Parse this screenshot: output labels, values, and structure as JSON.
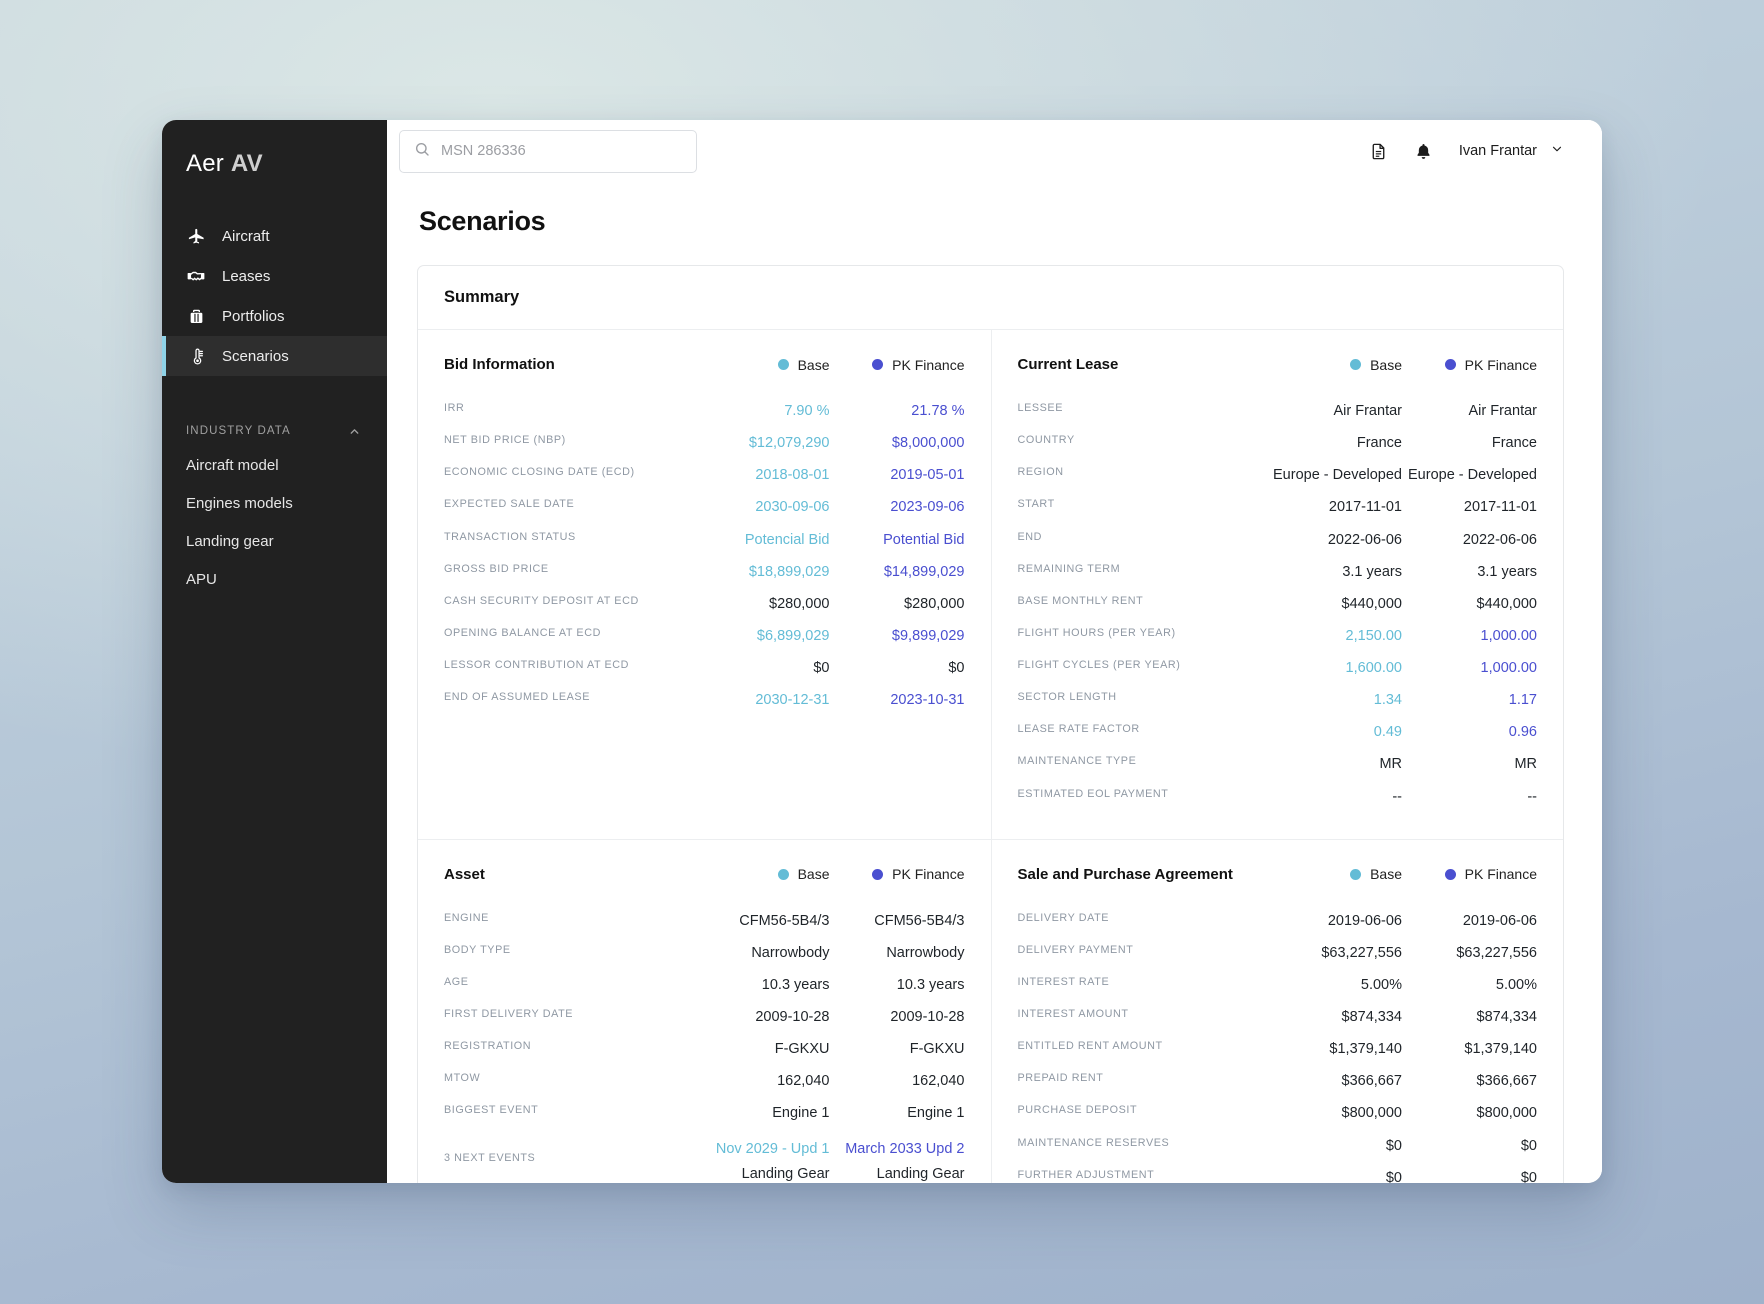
{
  "brand": {
    "part1": "Aer",
    "part2": "AV"
  },
  "sidebar": {
    "items": [
      {
        "label": "Aircraft",
        "icon": "airplane-icon",
        "active": false
      },
      {
        "label": "Leases",
        "icon": "handshake-icon",
        "active": false
      },
      {
        "label": "Portfolios",
        "icon": "briefcase-icon",
        "active": false
      },
      {
        "label": "Scenarios",
        "icon": "thermometer-icon",
        "active": true
      }
    ],
    "section": {
      "label": "INDUSTRY DATA",
      "chevron": "chevron-up-icon"
    },
    "sub_items": [
      {
        "label": "Aircraft model"
      },
      {
        "label": "Engines models"
      },
      {
        "label": "Landing gear"
      },
      {
        "label": "APU"
      }
    ]
  },
  "topbar": {
    "search": {
      "placeholder": "MSN 286336",
      "value": "",
      "icon": "search-icon"
    },
    "document_icon": "document-icon",
    "notifications_icon": "bell-icon",
    "user": {
      "name": "Ivan Frantar",
      "chevron": "chevron-down-icon"
    }
  },
  "page": {
    "title": "Scenarios"
  },
  "card": {
    "title": "Summary"
  },
  "colors": {
    "base": "#63bcd6",
    "pk": "#4a4fd0",
    "accent": "#8fd3e8"
  },
  "legend": {
    "base": "Base",
    "pk": "PK Finance"
  },
  "panels": {
    "bid_information": {
      "title": "Bid Information",
      "rows": [
        {
          "label": "IRR",
          "base": "7.90 %",
          "pk": "21.78 %",
          "base_color": "base",
          "pk_color": "pk"
        },
        {
          "label": "NET BID PRICE (NBP)",
          "base": "$12,079,290",
          "pk": "$8,000,000",
          "base_color": "base",
          "pk_color": "pk"
        },
        {
          "label": "ECONOMIC CLOSING DATE (ECD)",
          "base": "2018-08-01",
          "pk": "2019-05-01",
          "base_color": "base",
          "pk_color": "pk"
        },
        {
          "label": "EXPECTED SALE DATE",
          "base": "2030-09-06",
          "pk": "2023-09-06",
          "base_color": "base",
          "pk_color": "pk"
        },
        {
          "label": "TRANSACTION STATUS",
          "base": "Potencial Bid",
          "pk": "Potential Bid",
          "base_color": "base",
          "pk_color": "pk"
        },
        {
          "label": "GROSS BID PRICE",
          "base": "$18,899,029",
          "pk": "$14,899,029",
          "base_color": "base",
          "pk_color": "pk"
        },
        {
          "label": "CASH SECURITY DEPOSIT AT ECD",
          "base": "$280,000",
          "pk": "$280,000",
          "base_color": "plain",
          "pk_color": "plain"
        },
        {
          "label": "OPENING BALANCE AT ECD",
          "base": "$6,899,029",
          "pk": "$9,899,029",
          "base_color": "base",
          "pk_color": "pk"
        },
        {
          "label": "LESSOR CONTRIBUTION AT ECD",
          "base": "$0",
          "pk": "$0",
          "base_color": "plain",
          "pk_color": "plain"
        },
        {
          "label": "END OF ASSUMED LEASE",
          "base": "2030-12-31",
          "pk": "2023-10-31",
          "base_color": "base",
          "pk_color": "pk"
        }
      ]
    },
    "current_lease": {
      "title": "Current Lease",
      "rows": [
        {
          "label": "LESSEE",
          "base": "Air Frantar",
          "pk": "Air Frantar",
          "base_color": "plain",
          "pk_color": "plain"
        },
        {
          "label": "COUNTRY",
          "base": "France",
          "pk": "France",
          "base_color": "plain",
          "pk_color": "plain"
        },
        {
          "label": "REGION",
          "base": "Europe - Developed",
          "pk": "Europe - Developed",
          "base_color": "plain",
          "pk_color": "plain"
        },
        {
          "label": "START",
          "base": "2017-11-01",
          "pk": "2017-11-01",
          "base_color": "plain",
          "pk_color": "plain"
        },
        {
          "label": "END",
          "base": "2022-06-06",
          "pk": "2022-06-06",
          "base_color": "plain",
          "pk_color": "plain"
        },
        {
          "label": "REMAINING TERM",
          "base": "3.1 years",
          "pk": "3.1 years",
          "base_color": "plain",
          "pk_color": "plain"
        },
        {
          "label": "BASE MONTHLY RENT",
          "base": "$440,000",
          "pk": "$440,000",
          "base_color": "plain",
          "pk_color": "plain"
        },
        {
          "label": "FLIGHT HOURS (PER YEAR)",
          "base": "2,150.00",
          "pk": "1,000.00",
          "base_color": "base",
          "pk_color": "pk"
        },
        {
          "label": "FLIGHT CYCLES (PER YEAR)",
          "base": "1,600.00",
          "pk": "1,000.00",
          "base_color": "base",
          "pk_color": "pk"
        },
        {
          "label": "SECTOR LENGTH",
          "base": "1.34",
          "pk": "1.17",
          "base_color": "base",
          "pk_color": "pk"
        },
        {
          "label": "LEASE RATE FACTOR",
          "base": "0.49",
          "pk": "0.96",
          "base_color": "base",
          "pk_color": "pk"
        },
        {
          "label": "MAINTENANCE TYPE",
          "base": "MR",
          "pk": "MR",
          "base_color": "plain",
          "pk_color": "plain"
        },
        {
          "label": "ESTIMATED EOL PAYMENT",
          "base": "--",
          "pk": "--",
          "base_color": "plain",
          "pk_color": "plain"
        }
      ]
    },
    "asset": {
      "title": "Asset",
      "rows": [
        {
          "label": "ENGINE",
          "base": "CFM56-5B4/3",
          "pk": "CFM56-5B4/3",
          "base_color": "plain",
          "pk_color": "plain"
        },
        {
          "label": "BODY TYPE",
          "base": "Narrowbody",
          "pk": "Narrowbody",
          "base_color": "plain",
          "pk_color": "plain"
        },
        {
          "label": "AGE",
          "base": "10.3 years",
          "pk": "10.3 years",
          "base_color": "plain",
          "pk_color": "plain"
        },
        {
          "label": "FIRST DELIVERY DATE",
          "base": "2009-10-28",
          "pk": "2009-10-28",
          "base_color": "plain",
          "pk_color": "plain"
        },
        {
          "label": "REGISTRATION",
          "base": "F-GKXU",
          "pk": "F-GKXU",
          "base_color": "plain",
          "pk_color": "plain"
        },
        {
          "label": "MTOW",
          "base": "162,040",
          "pk": "162,040",
          "base_color": "plain",
          "pk_color": "plain"
        },
        {
          "label": "BIGGEST EVENT",
          "base": "Engine 1",
          "pk": "Engine 1",
          "base_color": "plain",
          "pk_color": "plain"
        }
      ],
      "next_events": {
        "label": "3 NEXT EVENTS",
        "base_lines": [
          {
            "text": "Nov 2029 - Upd 1",
            "color": "base"
          },
          {
            "text": "Landing Gear",
            "color": "plain"
          }
        ],
        "pk_lines": [
          {
            "text": "March 2033 Upd 2",
            "color": "pk"
          },
          {
            "text": "Landing Gear",
            "color": "plain"
          }
        ]
      }
    },
    "sale_and_purchase": {
      "title": "Sale and Purchase Agreement",
      "rows": [
        {
          "label": "DELIVERY DATE",
          "base": "2019-06-06",
          "pk": "2019-06-06",
          "base_color": "plain",
          "pk_color": "plain"
        },
        {
          "label": "DELIVERY PAYMENT",
          "base": "$63,227,556",
          "pk": "$63,227,556",
          "base_color": "plain",
          "pk_color": "plain"
        },
        {
          "label": "INTEREST RATE",
          "base": "5.00%",
          "pk": "5.00%",
          "base_color": "plain",
          "pk_color": "plain"
        },
        {
          "label": "INTEREST AMOUNT",
          "base": "$874,334",
          "pk": "$874,334",
          "base_color": "plain",
          "pk_color": "plain"
        },
        {
          "label": "ENTITLED RENT AMOUNT",
          "base": "$1,379,140",
          "pk": "$1,379,140",
          "base_color": "plain",
          "pk_color": "plain"
        },
        {
          "label": "PREPAID RENT",
          "base": "$366,667",
          "pk": "$366,667",
          "base_color": "plain",
          "pk_color": "plain"
        },
        {
          "label": "PURCHASE DEPOSIT",
          "base": "$800,000",
          "pk": "$800,000",
          "base_color": "plain",
          "pk_color": "plain"
        },
        {
          "label": "MAINTENANCE RESERVES",
          "base": "$0",
          "pk": "$0",
          "base_color": "plain",
          "pk_color": "plain"
        },
        {
          "label": "FURTHER ADJUSTMENT",
          "base": "$0",
          "pk": "$0",
          "base_color": "plain",
          "pk_color": "plain"
        }
      ]
    }
  }
}
